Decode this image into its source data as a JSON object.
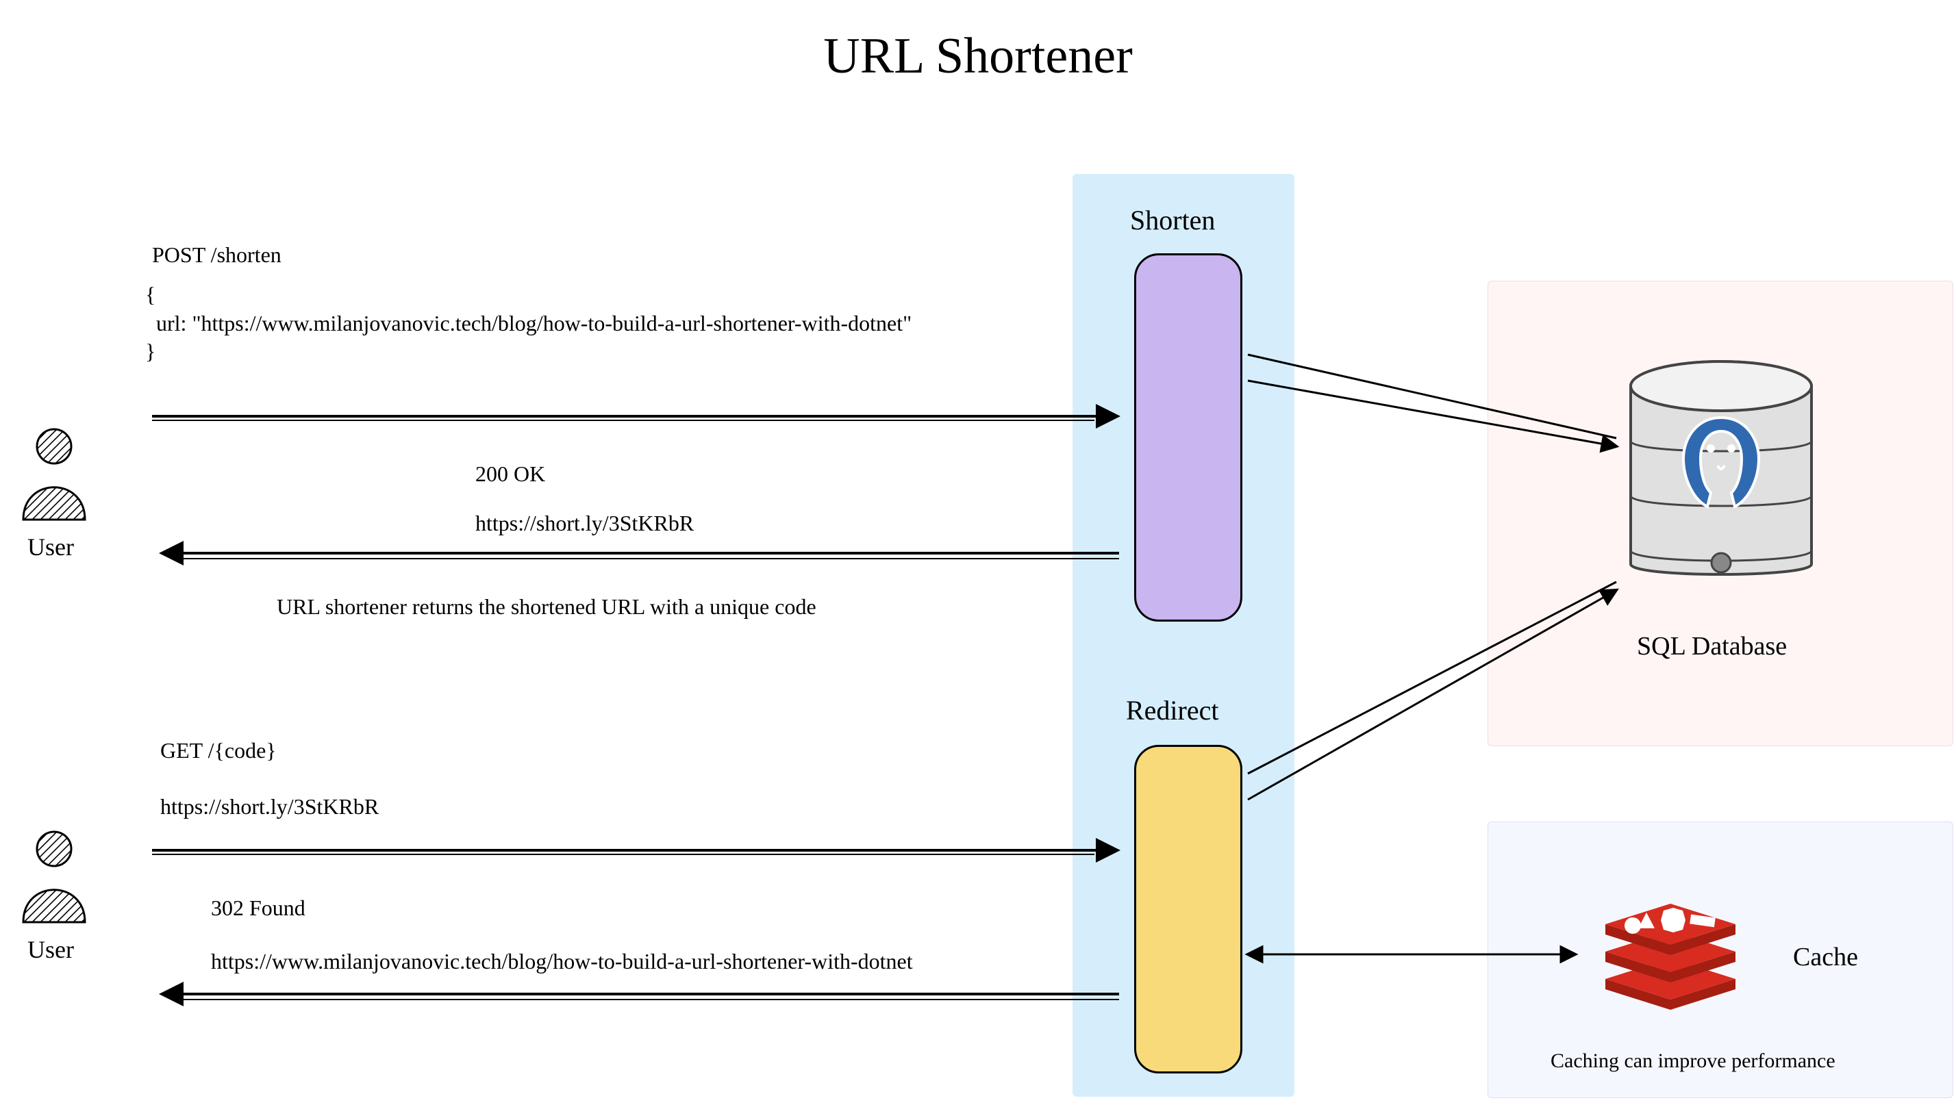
{
  "title": "URL Shortener",
  "user_label": "User",
  "shorten": {
    "label": "Shorten",
    "request_line": "POST /shorten",
    "request_body": "{\n  url: \"https://www.milanjovanovic.tech/blog/how-to-build-a-url-shortener-with-dotnet\"\n}",
    "response_status": "200 OK",
    "response_url": "https://short.ly/3StKRbR",
    "response_note": "URL shortener returns the shortened URL with a unique code"
  },
  "redirect": {
    "label": "Redirect",
    "request_line": "GET /{code}",
    "request_url": "https://short.ly/3StKRbR",
    "response_status": "302 Found",
    "response_url": "https://www.milanjovanovic.tech/blog/how-to-build-a-url-shortener-with-dotnet"
  },
  "database": {
    "label": "SQL Database"
  },
  "cache": {
    "label": "Cache",
    "note": "Caching can improve performance"
  }
}
